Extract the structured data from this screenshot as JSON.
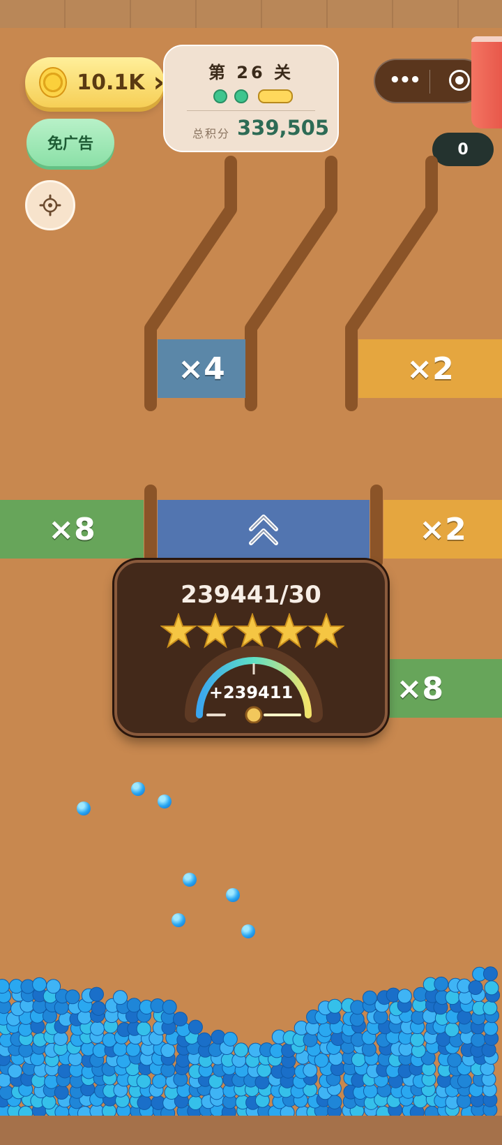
{
  "coins": {
    "amount": "10.1K",
    "arrow": "›"
  },
  "no_ads_label": "免广告",
  "level": {
    "text": "第 26 关",
    "score_label": "总积分",
    "score_value": "339,505",
    "progress_dots_done": 2,
    "progress_current": 3
  },
  "counter": "0",
  "multipliers": {
    "upper_left": "×4",
    "upper_right": "×2",
    "mid_left": "×8",
    "mid_right": "×2",
    "lower_right": "×8"
  },
  "result_panel": {
    "ratio": "239441/30",
    "stars": 5,
    "gain": "+239411",
    "gauge_level": 0.5
  },
  "colors": {
    "background": "#c8884f",
    "blue_zone": "#5b87a8",
    "orange_zone": "#e5a63f",
    "green_zone": "#67a55a",
    "boost_zone": "#5275b0",
    "ball": "#29a6f2"
  }
}
